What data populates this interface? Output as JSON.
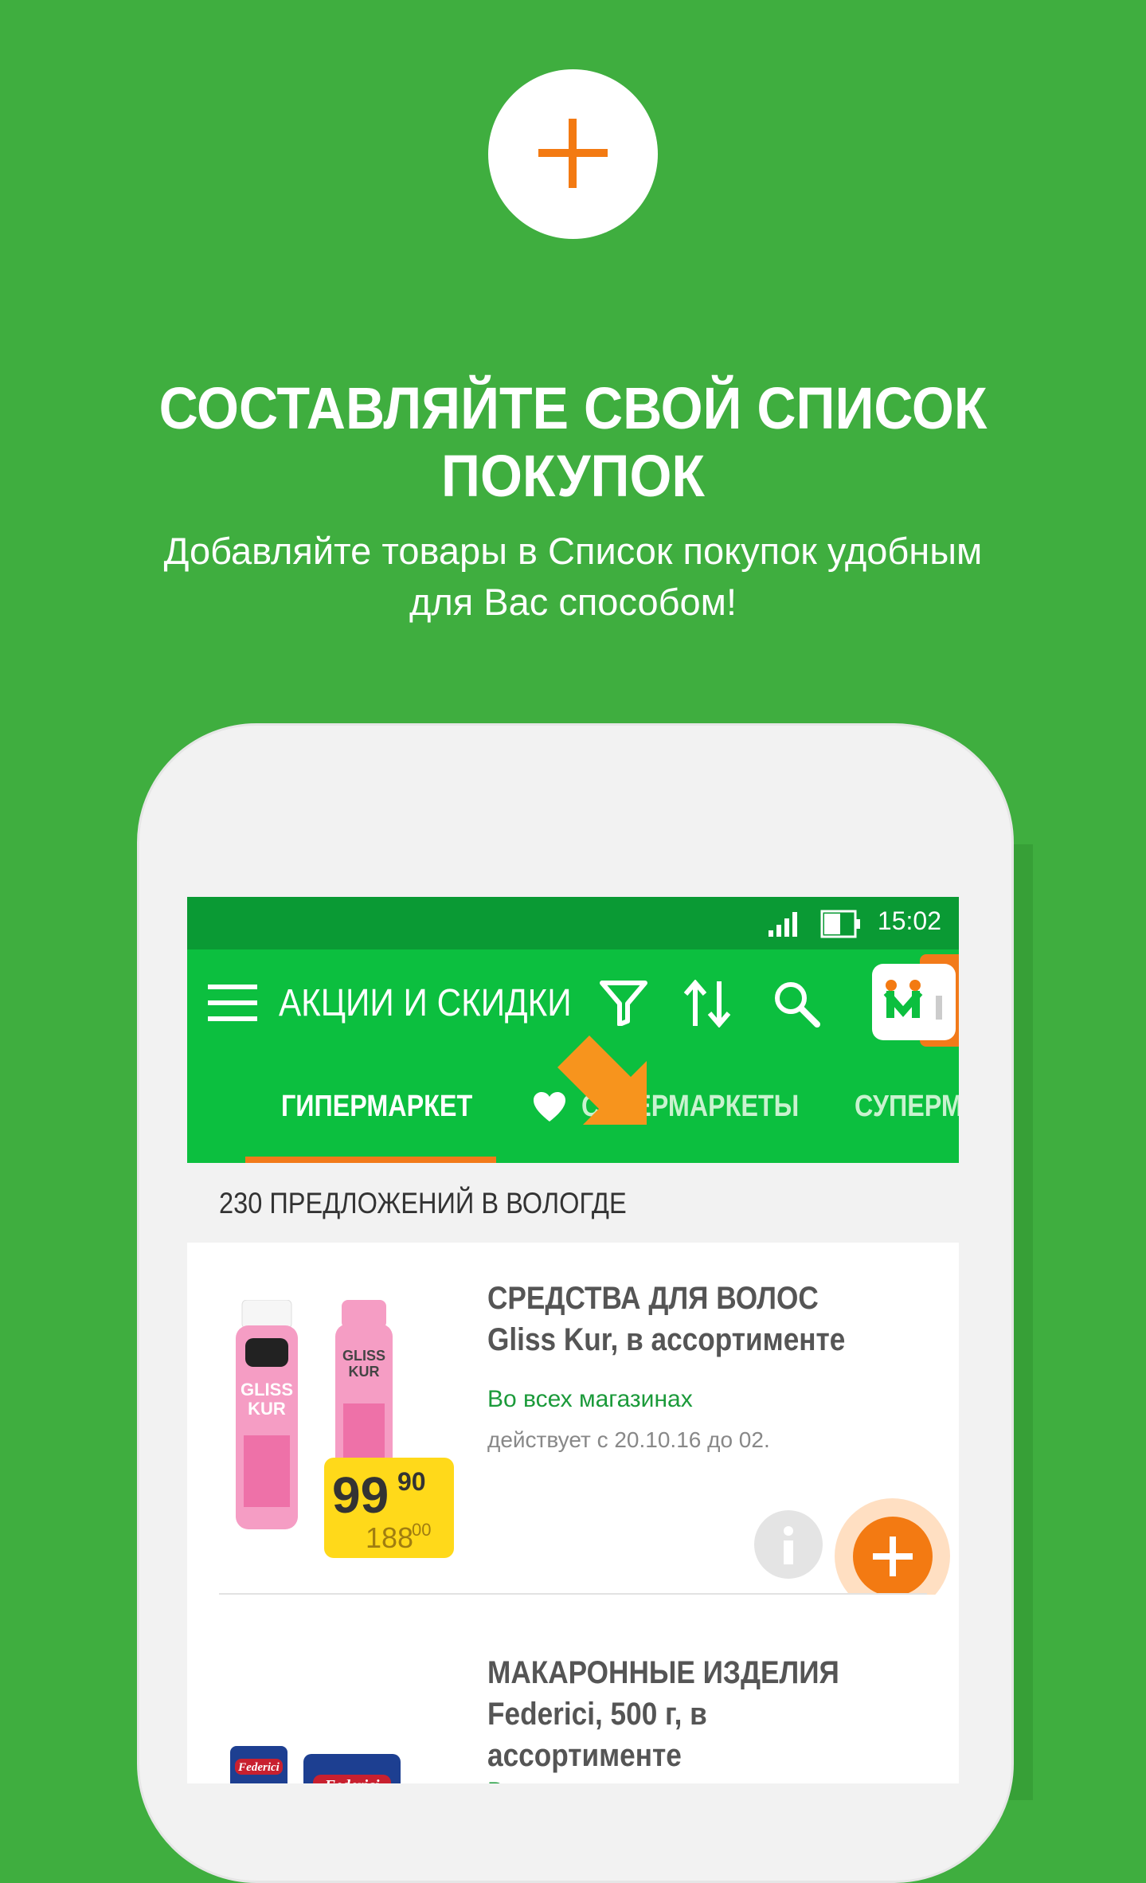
{
  "promo": {
    "headline": "СОСТАВЛЯЙТЕ СВОЙ СПИСОК ПОКУПОК",
    "subtext_line1": "Добавляйте товары в Список покупок удобным",
    "subtext_line2": "для Вас способом!"
  },
  "status_bar": {
    "time": "15:02"
  },
  "toolbar": {
    "title": "АКЦИИ И СКИДКИ",
    "icons": [
      "menu-icon",
      "filter-icon",
      "sort-icon",
      "search-icon",
      "app-logo-icon"
    ]
  },
  "tabs": [
    {
      "label": "ГИПЕРМАРКЕТ",
      "active": true
    },
    {
      "label": "СУПЕРМАРКЕТЫ",
      "active": false,
      "icon": "heart-icon"
    },
    {
      "label": "СУПЕРМ",
      "active": false
    }
  ],
  "offers": {
    "count_text": "230 ПРЕДЛОЖЕНИЙ В ВОЛОГДЕ"
  },
  "products": [
    {
      "title": "СРЕДСТВА ДЛЯ ВОЛОС Gliss Kur, в ассортименте",
      "availability": "Во всех магазинах",
      "validity": "действует с 20.10.16 до 02.",
      "price_new": "99",
      "price_new_cents": "90",
      "price_old": "188",
      "price_old_cents": "00"
    },
    {
      "title": "МАКАРОННЫЕ ИЗДЕЛИЯ Federici, 500 г, в ассортименте",
      "availability": "В",
      "validity": ""
    }
  ],
  "colors": {
    "background": "#3fae3f",
    "status_bar": "#0a9a34",
    "toolbar": "#0cbf3f",
    "accent": "#f37a12",
    "price_tag": "#ffd91a"
  }
}
